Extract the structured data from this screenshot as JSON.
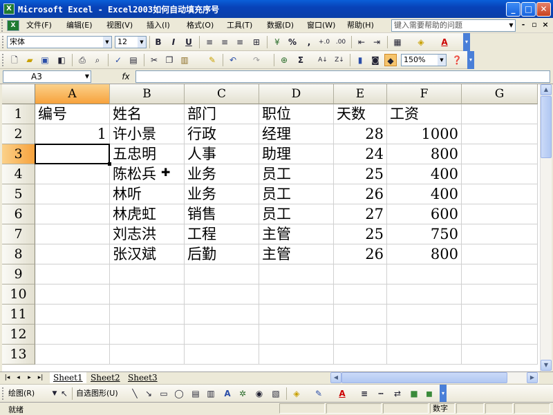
{
  "window": {
    "title": "Microsoft Excel - Excel2003如何自动填充序号",
    "app_icon": "X",
    "minimize": "_",
    "maximize": "□",
    "close": "✕"
  },
  "menu": {
    "items": [
      "文件(F)",
      "编辑(E)",
      "视图(V)",
      "插入(I)",
      "格式(O)",
      "工具(T)",
      "数据(D)",
      "窗口(W)",
      "帮助(H)"
    ],
    "help_placeholder": "键入需要帮助的问题",
    "doc_minimize": "-",
    "doc_restore": "▫",
    "doc_close": "×"
  },
  "format_toolbar": {
    "font": "宋体",
    "font_size": "12",
    "bold": "B",
    "italic": "I",
    "underline": "U",
    "percent": "%",
    "comma": ","
  },
  "standard_toolbar": {
    "zoom": "150%",
    "sum": "Σ"
  },
  "formula_bar": {
    "name_box": "A3",
    "fx": "fx",
    "formula": ""
  },
  "sheet": {
    "columns": [
      "A",
      "B",
      "C",
      "D",
      "E",
      "F",
      "G"
    ],
    "rows": [
      "1",
      "2",
      "3",
      "4",
      "5",
      "6",
      "7",
      "8",
      "9",
      "10",
      "11",
      "12",
      "13"
    ],
    "selected_column": "A",
    "selected_row": "3",
    "active_cell": "A3",
    "cells": [
      [
        "编号",
        "姓名",
        "部门",
        "职位",
        "天数",
        "工资",
        ""
      ],
      [
        "1",
        "许小景",
        "行政",
        "经理",
        "28",
        "1000",
        ""
      ],
      [
        "",
        "五忠明",
        "人事",
        "助理",
        "24",
        "800",
        ""
      ],
      [
        "",
        "陈松兵",
        "业务",
        "员工",
        "25",
        "400",
        ""
      ],
      [
        "",
        "林听",
        "业务",
        "员工",
        "26",
        "400",
        ""
      ],
      [
        "",
        "林虎虹",
        "销售",
        "员工",
        "27",
        "600",
        ""
      ],
      [
        "",
        "刘志洪",
        "工程",
        "主管",
        "25",
        "750",
        ""
      ],
      [
        "",
        "张汉斌",
        "后勤",
        "主管",
        "26",
        "800",
        ""
      ],
      [
        "",
        "",
        "",
        "",
        "",
        "",
        ""
      ],
      [
        "",
        "",
        "",
        "",
        "",
        "",
        ""
      ],
      [
        "",
        "",
        "",
        "",
        "",
        "",
        ""
      ],
      [
        "",
        "",
        "",
        "",
        "",
        "",
        ""
      ],
      [
        "",
        "",
        "",
        "",
        "",
        "",
        ""
      ]
    ],
    "numeric_columns": [
      0,
      4,
      5
    ],
    "cursor_glyph": "✚"
  },
  "tabs": {
    "sheets": [
      "Sheet1",
      "Sheet2",
      "Sheet3"
    ],
    "active": "Sheet1"
  },
  "drawing_toolbar": {
    "draw_menu": "绘图(R)",
    "autoshapes_menu": "自选图形(U)"
  },
  "status": {
    "left": "就绪",
    "mode": "数字"
  }
}
